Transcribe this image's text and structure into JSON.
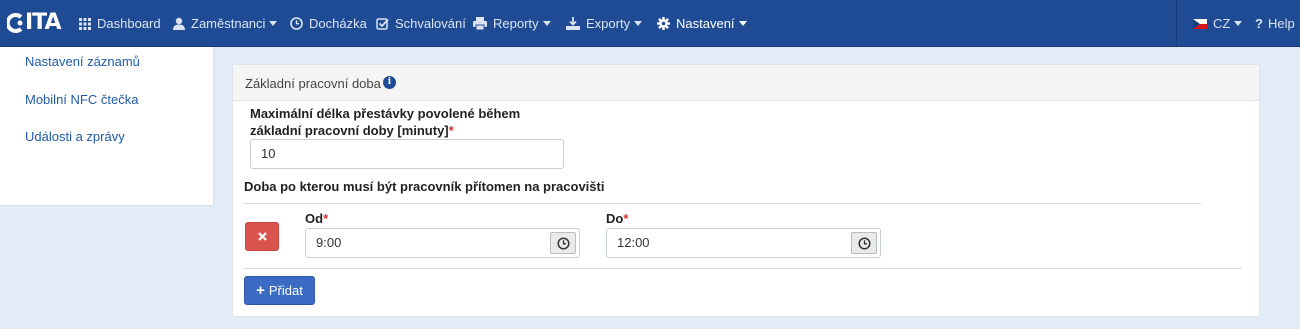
{
  "nav": {
    "logo": "ITA",
    "items": [
      {
        "label": "Dashboard",
        "icon": "grid-icon"
      },
      {
        "label": "Zaměstnanci",
        "icon": "user-icon"
      },
      {
        "label": "Docházka",
        "icon": "clock-icon"
      },
      {
        "label": "Schvalování",
        "icon": "check-square-icon"
      },
      {
        "label": "Reporty",
        "icon": "print-icon"
      },
      {
        "label": "Exporty",
        "icon": "download-icon"
      },
      {
        "label": "Nastavení",
        "icon": "gear-icon",
        "active": true
      }
    ],
    "language": "CZ",
    "help": "Help"
  },
  "sidebar": {
    "items": [
      {
        "label": "Nastavení záznamů"
      },
      {
        "label": "Mobilní NFC čtečka"
      },
      {
        "label": "Události a zprávy"
      }
    ]
  },
  "panel": {
    "title": "Základní pracovní doba",
    "break_label_line1": "Maximální délka přestávky povolené během",
    "break_label_line2": "základní pracovní doby [minuty]",
    "required_mark": "*",
    "break_value": "10",
    "presence_label": "Doba po kterou musí být pracovník přítomen na pracovišti",
    "from_label": "Od",
    "to_label": "Do",
    "from_value": "9:00",
    "to_value": "12:00",
    "add_button": "Přidat"
  },
  "colors": {
    "navbar": "#1f4b94",
    "delete": "#d9534f",
    "primary": "#3a6cc4",
    "required": "#d9302c"
  }
}
